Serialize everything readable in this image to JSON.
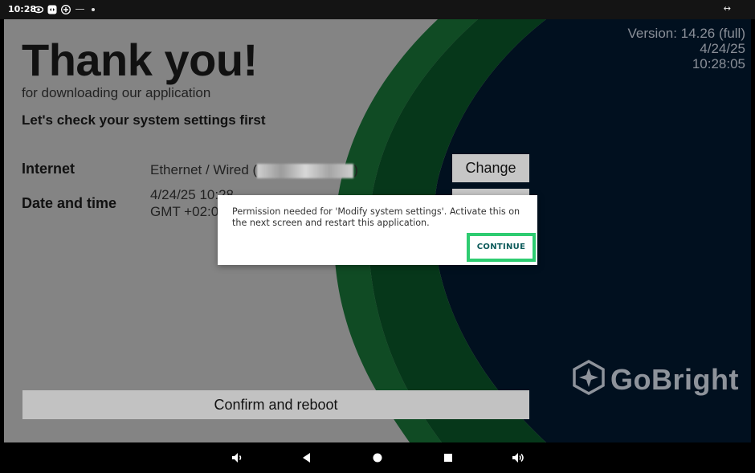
{
  "status_bar": {
    "time": "10:28"
  },
  "version": {
    "line1": "Version: 14.26 (full)",
    "line2": "4/24/25",
    "line3": "10:28:05"
  },
  "header": {
    "title": "Thank you!",
    "subtitle": "for downloading our application",
    "check": "Let's check your system settings first"
  },
  "settings": {
    "internet_label": "Internet",
    "internet_value_prefix": "Ethernet / Wired (",
    "internet_value_suffix": ")",
    "change_label": "Change",
    "datetime_label": "Date and time",
    "datetime_line1": "4/24/25 10:28",
    "datetime_line2": "GMT +02:0"
  },
  "confirm_label": "Confirm and reboot",
  "brand": {
    "name": "GoBright"
  },
  "dialog": {
    "message": "Permission needed for 'Modify system settings'. Activate this on the next screen and restart this application.",
    "continue_label": "CONTINUE"
  },
  "colors": {
    "navy": "#021a33",
    "green_light": "#1a7a3a",
    "green_dark": "#0a5a2a",
    "highlight": "#2ecc71"
  }
}
